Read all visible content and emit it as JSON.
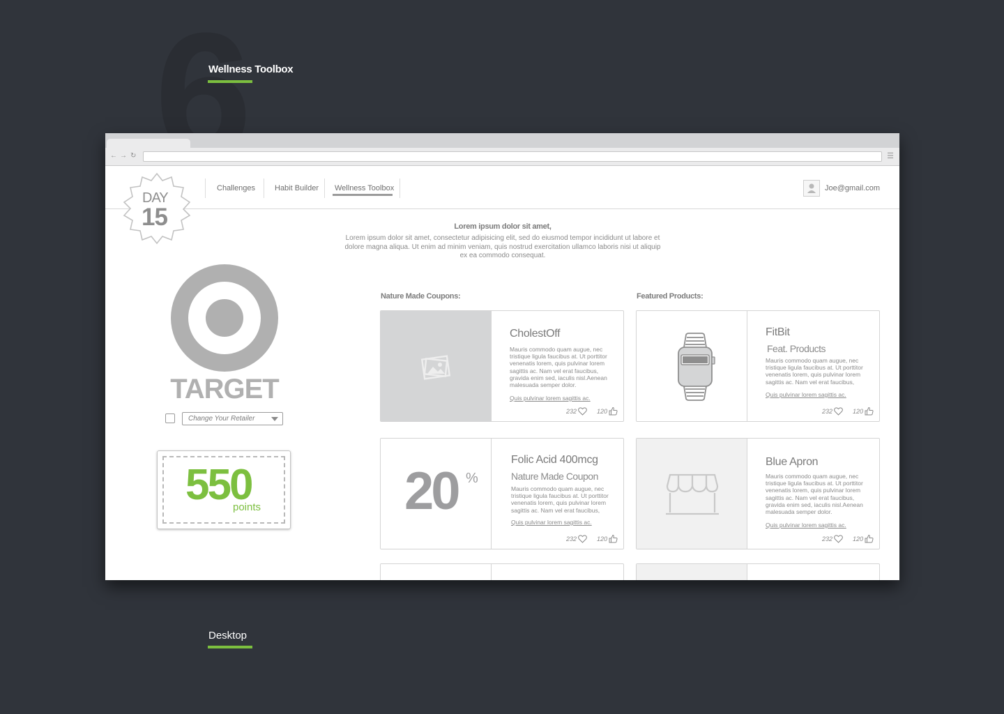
{
  "section": {
    "number": "6",
    "title": "Wellness Toolbox",
    "footer_label": "Desktop"
  },
  "accent_color": "#7cbf3f",
  "badge": {
    "day_label": "DAY",
    "day_number": "15"
  },
  "nav": {
    "items": [
      "Challenges",
      "Habit Builder",
      "Wellness Toolbox"
    ],
    "active": "Wellness Toolbox"
  },
  "user": {
    "email": "Joe@gmail.com"
  },
  "intro": {
    "title": "Lorem ipsum dolor sit amet,",
    "body": "Lorem ipsum dolor sit amet, consectetur adipisicing elit, sed do eiusmod tempor incididunt ut labore et dolore magna aliqua. Ut enim ad minim veniam, quis nostrud exercitation ullamco laboris nisi ut aliquip ex ea commodo consequat."
  },
  "retailer": {
    "name": "TARGET",
    "select_label": "Change Your Retailer"
  },
  "points": {
    "value": "550",
    "label": "points"
  },
  "coupons": {
    "label": "Nature Made Coupons:",
    "cards": [
      {
        "title": "CholestOff",
        "subtitle": "",
        "body": "Mauris commodo quam augue, nec tristique ligula faucibus at. Ut porttitor venenatis lorem, quis pulvinar lorem sagittis ac. Nam vel erat faucibus, gravida enim sed, iaculis nisl.Aenean malesuada semper dolor.",
        "link": "Quis pulvinar lorem sagittis ac.",
        "likes": "232",
        "thumbs": "120",
        "media": "image-placeholder-icon"
      },
      {
        "title": "Folic Acid 400mcg",
        "subtitle": "Nature Made Coupon",
        "body": "Mauris commodo quam augue, nec tristique ligula faucibus at. Ut porttitor venenatis lorem, quis pulvinar lorem sagittis ac. Nam vel erat faucibus,",
        "link": "Quis pulvinar lorem sagittis ac.",
        "likes": "232",
        "thumbs": "120",
        "discount_number": "20",
        "discount_symbol": "%"
      }
    ]
  },
  "featured": {
    "label": "Featured Products:",
    "cards": [
      {
        "title": "FitBit",
        "subtitle": "Feat. Products",
        "body": "Mauris commodo quam augue, nec tristique ligula faucibus at. Ut porttitor venenatis lorem, quis pulvinar lorem sagittis ac. Nam vel erat faucibus,",
        "link": "Quis pulvinar lorem sagittis ac.",
        "likes": "232",
        "thumbs": "120",
        "media": "watch-icon"
      },
      {
        "title": "Blue Apron",
        "subtitle": "",
        "body": "Mauris commodo quam augue, nec tristique ligula faucibus at. Ut porttitor venenatis lorem, quis pulvinar lorem sagittis ac. Nam vel erat faucibus, gravida enim sed, iaculis nisl.Aenean malesuada semper dolor.",
        "link": "Quis pulvinar lorem sagittis ac.",
        "likes": "232",
        "thumbs": "120",
        "media": "storefront-icon"
      }
    ]
  }
}
